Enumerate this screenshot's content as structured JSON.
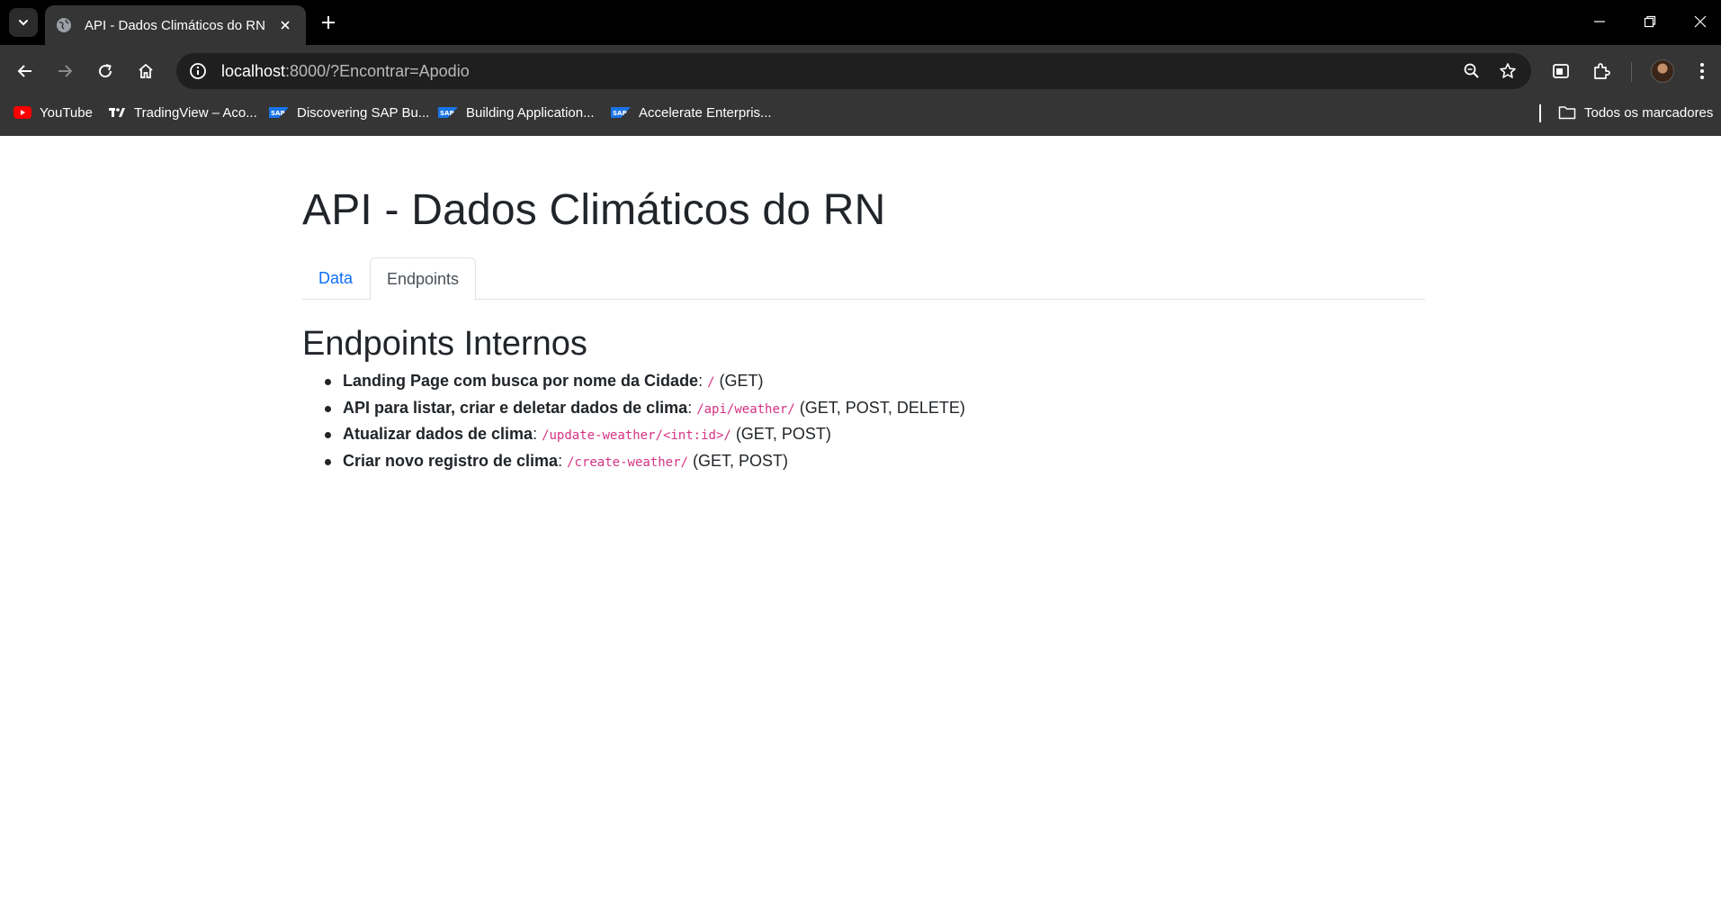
{
  "browser": {
    "tab_title": "API - Dados Climáticos do RN",
    "url_host": "localhost",
    "url_rest": ":8000/?Encontrar=Apodio",
    "bookmarks": [
      {
        "label": "YouTube",
        "icon": "youtube-icon"
      },
      {
        "label": "TradingView – Aco...",
        "icon": "tradingview-icon"
      },
      {
        "label": "Discovering SAP Bu...",
        "icon": "sap-icon"
      },
      {
        "label": "Building Application...",
        "icon": "sap-icon"
      },
      {
        "label": "Accelerate Enterpris...",
        "icon": "sap-icon"
      }
    ],
    "all_bookmarks_label": "Todos os marcadores"
  },
  "page": {
    "title": "API - Dados Climáticos do RN",
    "tabs": [
      {
        "label": "Data",
        "active": false
      },
      {
        "label": "Endpoints",
        "active": true
      }
    ],
    "section_title": "Endpoints Internos",
    "endpoints": [
      {
        "name": "Landing Page com busca por nome da Cidade",
        "path": "/",
        "methods": "(GET)"
      },
      {
        "name": "API para listar, criar e deletar dados de clima",
        "path": "/api/weather/",
        "methods": "(GET, POST, DELETE)"
      },
      {
        "name": "Atualizar dados de clima",
        "path": "/update-weather/<int:id>/",
        "methods": "(GET, POST)"
      },
      {
        "name": "Criar novo registro de clima",
        "path": "/create-weather/",
        "methods": "(GET, POST)"
      }
    ]
  },
  "colors": {
    "link": "#0d6efd",
    "code": "#d63384",
    "text": "#212529",
    "chrome_bg": "#353535",
    "tabstrip_bg": "#000000"
  }
}
